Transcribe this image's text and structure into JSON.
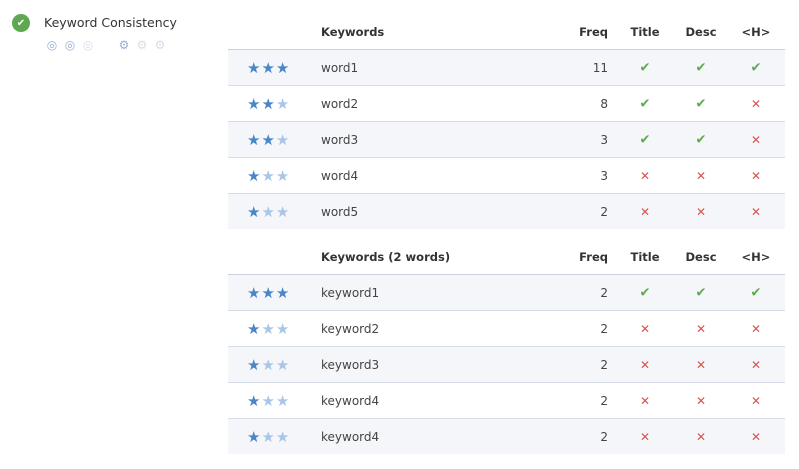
{
  "section": {
    "title": "Keyword Consistency",
    "status_icon": "check-icon",
    "colors": {
      "ok": "#5ea94f",
      "fail": "#d9534f",
      "star": "#4a86c8",
      "star_off": "#a9c6e6"
    }
  },
  "columns": {
    "freq": "Freq",
    "title": "Title",
    "desc": "Desc",
    "h": "<H>"
  },
  "tables": [
    {
      "header": "Keywords",
      "rows": [
        {
          "stars": 3,
          "keyword": "word1",
          "freq": "11",
          "title": true,
          "desc": true,
          "h": true
        },
        {
          "stars": 2,
          "keyword": "word2",
          "freq": "8",
          "title": true,
          "desc": true,
          "h": false
        },
        {
          "stars": 2,
          "keyword": "word3",
          "freq": "3",
          "title": true,
          "desc": true,
          "h": false
        },
        {
          "stars": 1,
          "keyword": "word4",
          "freq": "3",
          "title": false,
          "desc": false,
          "h": false
        },
        {
          "stars": 1,
          "keyword": "word5",
          "freq": "2",
          "title": false,
          "desc": false,
          "h": false
        }
      ]
    },
    {
      "header": "Keywords (2 words)",
      "rows": [
        {
          "stars": 3,
          "keyword": "keyword1",
          "freq": "2",
          "title": true,
          "desc": true,
          "h": true
        },
        {
          "stars": 1,
          "keyword": "keyword2",
          "freq": "2",
          "title": false,
          "desc": false,
          "h": false
        },
        {
          "stars": 1,
          "keyword": "keyword3",
          "freq": "2",
          "title": false,
          "desc": false,
          "h": false
        },
        {
          "stars": 1,
          "keyword": "keyword4",
          "freq": "2",
          "title": false,
          "desc": false,
          "h": false
        },
        {
          "stars": 1,
          "keyword": "keyword4",
          "freq": "2",
          "title": false,
          "desc": false,
          "h": false
        }
      ]
    }
  ]
}
